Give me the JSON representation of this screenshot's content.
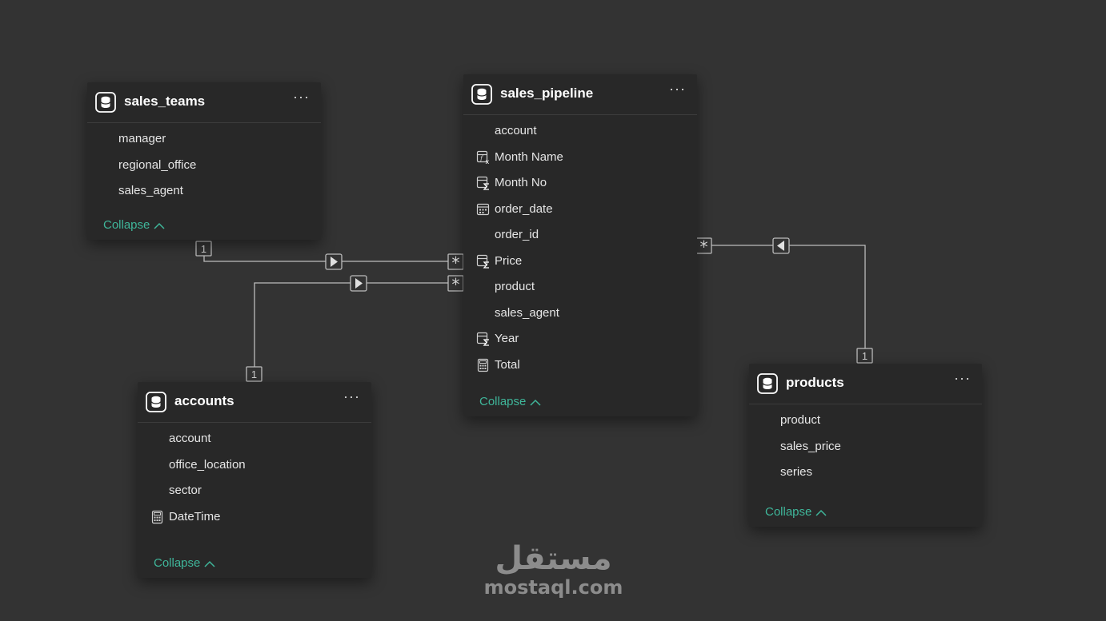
{
  "tables": {
    "sales_teams": {
      "name": "sales_teams",
      "fields": [
        {
          "name": "manager",
          "icon": ""
        },
        {
          "name": "regional_office",
          "icon": ""
        },
        {
          "name": "sales_agent",
          "icon": ""
        }
      ],
      "collapse_label": "Collapse"
    },
    "sales_pipeline": {
      "name": "sales_pipeline",
      "fields": [
        {
          "name": "account",
          "icon": ""
        },
        {
          "name": "Month Name",
          "icon": "calculated-column-icon"
        },
        {
          "name": "Month No",
          "icon": "sum-icon"
        },
        {
          "name": "order_date",
          "icon": "calendar-icon"
        },
        {
          "name": "order_id",
          "icon": ""
        },
        {
          "name": "Price",
          "icon": "sum-icon"
        },
        {
          "name": "product",
          "icon": ""
        },
        {
          "name": "sales_agent",
          "icon": ""
        },
        {
          "name": "Year",
          "icon": "sum-icon"
        },
        {
          "name": "Total",
          "icon": "calculator-icon"
        }
      ],
      "collapse_label": "Collapse"
    },
    "accounts": {
      "name": "accounts",
      "fields": [
        {
          "name": "account",
          "icon": ""
        },
        {
          "name": "office_location",
          "icon": ""
        },
        {
          "name": "sector",
          "icon": ""
        },
        {
          "name": "DateTime",
          "icon": "calculator-icon"
        }
      ],
      "collapse_label": "Collapse"
    },
    "products": {
      "name": "products",
      "fields": [
        {
          "name": "product",
          "icon": ""
        },
        {
          "name": "sales_price",
          "icon": ""
        },
        {
          "name": "series",
          "icon": ""
        }
      ],
      "collapse_label": "Collapse"
    }
  },
  "more_label": "···",
  "relationships": [
    {
      "from": "sales_teams",
      "to": "sales_pipeline",
      "from_cardinality": "1",
      "to_cardinality": "*",
      "direction": "right"
    },
    {
      "from": "accounts",
      "to": "sales_pipeline",
      "from_cardinality": "1",
      "to_cardinality": "*",
      "direction": "right"
    },
    {
      "from": "products",
      "to": "sales_pipeline",
      "from_cardinality": "1",
      "to_cardinality": "*",
      "direction": "left"
    }
  ],
  "watermark": {
    "arabic": "مستقل",
    "latin": "mostaql.com"
  },
  "colors": {
    "background": "#333333",
    "card": "#282828",
    "accent": "#3fb69a",
    "line": "#bdbdbd"
  }
}
